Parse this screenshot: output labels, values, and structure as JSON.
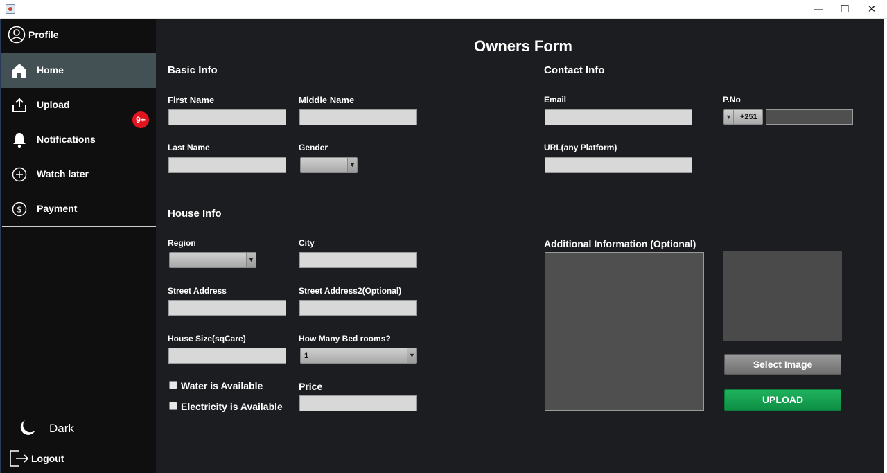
{
  "window": {
    "controls": {
      "minimize": "—",
      "maximize": "☐",
      "close": "✕"
    }
  },
  "sidebar": {
    "profile_label": "Profile",
    "items": [
      {
        "label": "Home",
        "icon": "home-icon",
        "active": true
      },
      {
        "label": "Upload",
        "icon": "upload-icon",
        "active": false
      },
      {
        "label": "Notifications",
        "icon": "bell-icon",
        "active": false,
        "badge": "9+"
      },
      {
        "label": "Watch later",
        "icon": "plus-circle-icon",
        "active": false
      },
      {
        "label": "Payment",
        "icon": "dollar-circle-icon",
        "active": false
      }
    ],
    "dark_label": "Dark",
    "logout_label": "Logout"
  },
  "form": {
    "title": "Owners Form",
    "basic_info": {
      "heading": "Basic Info",
      "first_name": "First Name",
      "middle_name": "Middle Name",
      "last_name": "Last Name",
      "gender": "Gender"
    },
    "contact_info": {
      "heading": "Contact Info",
      "email": "Email",
      "phone": "P.No",
      "phone_code": "+251",
      "url": "URL(any Platform)"
    },
    "house_info": {
      "heading": "House Info",
      "region": "Region",
      "city": "City",
      "street_address": "Street Address",
      "street_address2": "Street Address2(Optional)",
      "house_size": "House Size(sqCare)",
      "bedrooms": "How Many Bed rooms?",
      "bedrooms_value": "1",
      "water": "Water is Available",
      "electricity": "Electricity is Available",
      "price": "Price"
    },
    "additional_info": "Additional Information (Optional)",
    "select_image_label": "Select Image",
    "upload_label": "UPLOAD"
  },
  "colors": {
    "sidebar_bg": "#0f0f10",
    "main_bg": "#1c1d20",
    "active_item": "#435154",
    "badge": "#e2141f",
    "upload_button": "#14a04f"
  }
}
